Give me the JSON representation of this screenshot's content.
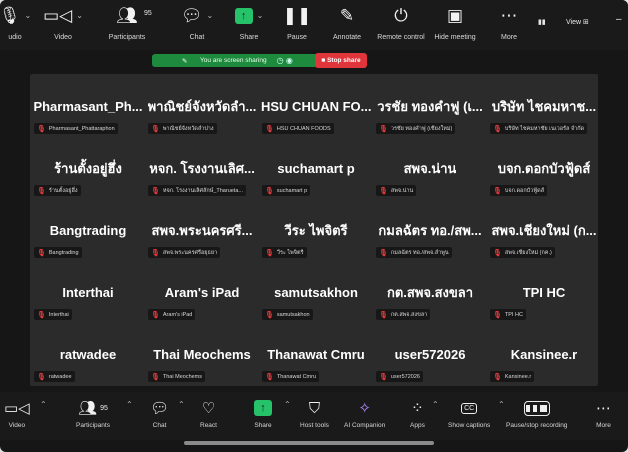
{
  "top_toolbar": {
    "audio": {
      "label": "udio",
      "icon": "microphone-icon"
    },
    "video": {
      "label": "Video",
      "icon": "video-camera-icon"
    },
    "participants": {
      "label": "Participants",
      "icon": "people-icon",
      "count": "95"
    },
    "chat": {
      "label": "Chat",
      "icon": "chat-bubble-icon"
    },
    "share": {
      "label": "Share",
      "icon": "share-screen-icon",
      "glyph": "↑"
    },
    "pause": {
      "label": "Pause",
      "icon": "pause-icon"
    },
    "annotate": {
      "label": "Annotate",
      "icon": "pen-icon"
    },
    "remote_control": {
      "label": "Remote control",
      "icon": "remote-control-icon"
    },
    "hide_meeting": {
      "label": "Hide meeting",
      "icon": "hide-window-icon"
    },
    "more": {
      "label": "More",
      "icon": "more-dots-icon"
    },
    "view": {
      "label": "View"
    }
  },
  "share_banner": {
    "text": "You are screen sharing",
    "stop_label": "Stop share"
  },
  "participants": [
    {
      "name": "Pharmasant_Ph...",
      "label": "Pharmasant_Phattaraphon"
    },
    {
      "name": "พาณิชย์จังหวัดลำ...",
      "label": "พาณิชย์จังหวัดลำปาง"
    },
    {
      "name": "HSU CHUAN FO...",
      "label": "HSU CHUAN FOODS"
    },
    {
      "name": "วรชัย ทองคำฟู (เ...",
      "label": "วรชัย ทองคำฟู (เชียงใหม่)"
    },
    {
      "name": "บริษัท ไชคมหาช...",
      "label": "บริษัท ไชคมหาชัย เนเวอรัล จำกัด"
    },
    {
      "name": "ร้านตั้งอยู่ฮึ่ง",
      "label": "ร้านตั้งอยู่ฮึ่ง"
    },
    {
      "name": "หจก. โรงงานเลิศ...",
      "label": "หจก. โรงงานเลิศลักษ์_Tharueta..."
    },
    {
      "name": "suchamart p",
      "label": "suchamart p"
    },
    {
      "name": "สพจ.น่าน",
      "label": "สพจ.น่าน"
    },
    {
      "name": "บจก.ดอกบัวฟู้ดส์",
      "label": "บจก.ดอกบัวฟู้ดส์"
    },
    {
      "name": "Bangtrading",
      "label": "Bangtrading"
    },
    {
      "name": "สพจ.พระนครศรี...",
      "label": "สพจ.พระนครศรีอยุธยา"
    },
    {
      "name": "วีระ ไพจิตรี",
      "label": "วีระ ไพจิตรี"
    },
    {
      "name": "กมลฉัตร ทอ./สพ...",
      "label": "กมลฉัตร ทอ./สพจ.ลำพูน"
    },
    {
      "name": "สพจ.เชียงใหม่ (ก...",
      "label": "สพจ.เชียงใหม่ (กค.)"
    },
    {
      "name": "Interthai",
      "label": "Interthai"
    },
    {
      "name": "Aram's iPad",
      "label": "Aram's iPad"
    },
    {
      "name": "samutsakhon",
      "label": "samutsakhon"
    },
    {
      "name": "กต.สพจ.สงขลา",
      "label": "กต.สพจ.สงขลา"
    },
    {
      "name": "TPI HC",
      "label": "TPI HC"
    },
    {
      "name": "ratwadee",
      "label": "ratwadee"
    },
    {
      "name": "Thai Meochems",
      "label": "Thai Meochems"
    },
    {
      "name": "Thanawat Cmru",
      "label": "Thanawat Cmru"
    },
    {
      "name": "user572026",
      "label": "user572026"
    },
    {
      "name": "Kansinee.r",
      "label": "Kansinee.r"
    }
  ],
  "bottom_toolbar": {
    "video": {
      "label": "Video"
    },
    "participants": {
      "label": "Participants",
      "count": "95"
    },
    "chat": {
      "label": "Chat"
    },
    "react": {
      "label": "React"
    },
    "share": {
      "label": "Share",
      "glyph": "↑"
    },
    "host_tools": {
      "label": "Host tools"
    },
    "ai_companion": {
      "label": "AI Companion"
    },
    "apps": {
      "label": "Apps"
    },
    "show_captions": {
      "label": "Show captions",
      "glyph": "CC"
    },
    "pause_recording": {
      "label": "Pause/stop recording"
    },
    "more": {
      "label": "More"
    }
  },
  "colors": {
    "background": "#161616",
    "grid": "#2b2b2b",
    "share_green": "#25c26a",
    "banner_green": "#1d8a3d",
    "stop_red": "#e0353b",
    "mic_muted_red": "#e23b3b"
  }
}
